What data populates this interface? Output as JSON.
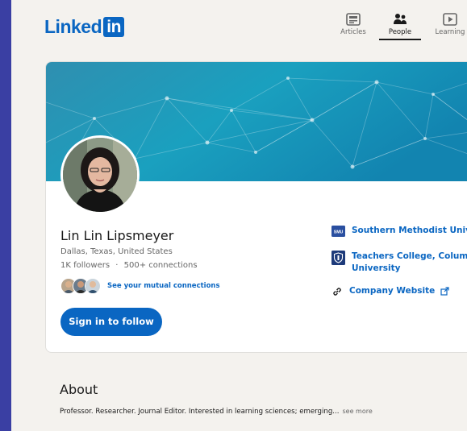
{
  "brand": {
    "logo_text": "Linked",
    "logo_badge": "in",
    "color": "#0a66c2"
  },
  "nav": {
    "items": [
      {
        "label": "Articles",
        "icon": "articles-icon"
      },
      {
        "label": "People",
        "icon": "people-icon",
        "active": true
      },
      {
        "label": "Learning",
        "icon": "learning-icon"
      }
    ]
  },
  "profile": {
    "name": "Lin Lin Lipsmeyer",
    "location": "Dallas, Texas, United States",
    "followers": "1K followers",
    "separator": "·",
    "connections": "500+ connections",
    "mutual_link": "See your mutual connections",
    "follow_button": "Sign in to follow"
  },
  "education": {
    "items": [
      {
        "badge": "SMU",
        "label": "Southern Methodist Unive"
      },
      {
        "label_line1": "Teachers College, Columbi",
        "label_line2": "University"
      }
    ],
    "company_website": "Company Website"
  },
  "about": {
    "title": "About",
    "text": "Professor. Researcher. Journal Editor. Interested in learning sciences; emerging...",
    "see_more": "see more"
  }
}
